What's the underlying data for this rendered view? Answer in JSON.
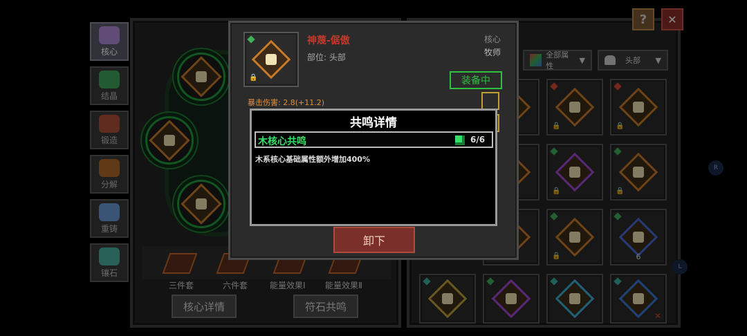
{
  "side_tabs": [
    {
      "label": "核心",
      "active": true,
      "color": "#b08ad8"
    },
    {
      "label": "结晶",
      "active": false,
      "color": "#3fa45a"
    },
    {
      "label": "锻造",
      "active": false,
      "color": "#b0503a"
    },
    {
      "label": "分解",
      "active": false,
      "color": "#b06a2a"
    },
    {
      "label": "重铸",
      "active": false,
      "color": "#6a9ad8"
    },
    {
      "label": "镶石",
      "active": false,
      "color": "#4ab0a0"
    }
  ],
  "set_effects": [
    "三件套",
    "六件套",
    "能量效果Ⅰ",
    "能量效果Ⅱ"
  ],
  "buttons": {
    "core_detail": "核心详情",
    "rune_resonance": "符石共鸣",
    "unequip": "卸下",
    "help": "?",
    "close": "✕"
  },
  "filters": {
    "attribute": "全部属性",
    "slot": "头部"
  },
  "item": {
    "name": "神蔑-倨傲",
    "part_label": "部位: 头部",
    "type": "核心",
    "class": "牧师",
    "status": "装备中",
    "crit_damage": "暴击伤害: 2.8(+11.2)"
  },
  "resonance_popup": {
    "title": "共鸣详情",
    "resonance_name": "木核心共鸣",
    "count": "6/6",
    "description": "木系核心基础属性额外增加400%"
  },
  "inventory_badge": "6",
  "side_markers": [
    "R",
    "L"
  ],
  "colors": {
    "accent_green": "#35e06a",
    "item_name": "#c0392b",
    "crit": "#e0903a",
    "equipped": "#2fbf3f"
  }
}
